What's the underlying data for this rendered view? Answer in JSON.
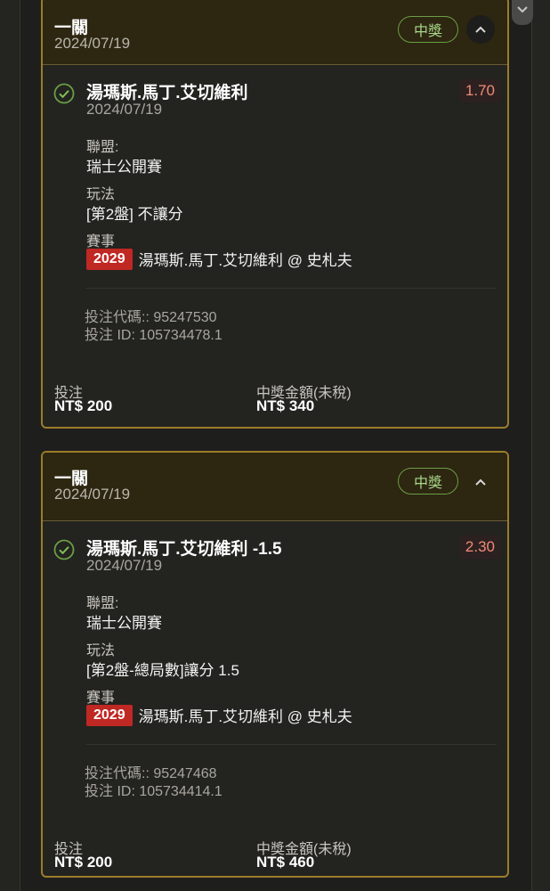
{
  "tickets": [
    {
      "header_title": "一關",
      "header_date": "2024/07/19",
      "status_badge": "中獎",
      "selection": "湯瑪斯.馬丁.艾切維利",
      "selection_date": "2024/07/19",
      "odds": "1.70",
      "league_label": "聯盟:",
      "league": "瑞士公開賽",
      "market_label": "玩法",
      "market": "[第2盤] 不讓分",
      "event_label": "賽事",
      "event_id": "2029",
      "event_name": "湯瑪斯.馬丁.艾切維利 @ 史札夫",
      "bet_code": "投注代碼:: 95247530",
      "bet_id": "投注 ID: 105734478.1",
      "stake_label": "投注",
      "stake": "NT$ 200",
      "payout_label": "中獎金額(未稅)",
      "payout": "NT$ 340"
    },
    {
      "header_title": "一關",
      "header_date": "2024/07/19",
      "status_badge": "中獎",
      "selection": "湯瑪斯.馬丁.艾切維利 -1.5",
      "selection_date": "2024/07/19",
      "odds": "2.30",
      "league_label": "聯盟:",
      "league": "瑞士公開賽",
      "market_label": "玩法",
      "market": "[第2盤-總局數]讓分 1.5",
      "event_label": "賽事",
      "event_id": "2029",
      "event_name": "湯瑪斯.馬丁.艾切維利 @ 史札夫",
      "bet_code": "投注代碼:: 95247468",
      "bet_id": "投注 ID: 105734414.1",
      "stake_label": "投注",
      "stake": "NT$ 200",
      "payout_label": "中獎金額(未稅)",
      "payout": "NT$ 460"
    }
  ],
  "icons": {
    "scroll_tab": "chevron-down-icon",
    "toggle": "chevron-up-icon",
    "status": "check-circle-icon"
  },
  "colors": {
    "card_border": "#9b7d2a",
    "win_badge": "#6b9e45",
    "odds": "#f08a78",
    "event_badge": "#c02823"
  }
}
